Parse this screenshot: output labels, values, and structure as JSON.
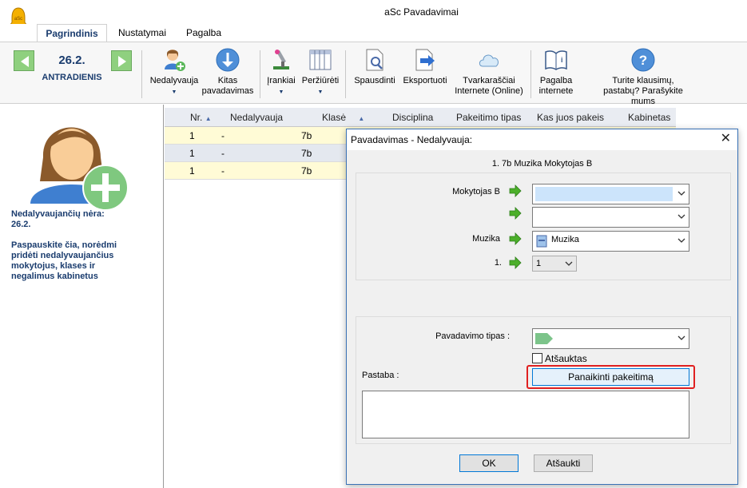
{
  "window": {
    "title": "aSc Pavadavimai"
  },
  "tabs": [
    {
      "label": "Pagrindinis",
      "active": true
    },
    {
      "label": "Nustatymai",
      "active": false
    },
    {
      "label": "Pagalba",
      "active": false
    }
  ],
  "date": {
    "value": "26.2.",
    "weekday": "ANTRADIENIS"
  },
  "toolbar": {
    "absent": {
      "line1": "Nedalyvauja",
      "line2": ""
    },
    "next": {
      "line1": "Kitas",
      "line2": "pavadavimas"
    },
    "tools": {
      "line1": "Įrankiai",
      "line2": ""
    },
    "view": {
      "line1": "Peržiūrėti",
      "line2": ""
    },
    "print": {
      "line1": "Spausdinti",
      "line2": ""
    },
    "export": {
      "line1": "Eksportuoti",
      "line2": ""
    },
    "online": {
      "line1": "Tvarkaraščiai",
      "line2": "Internete (Online)"
    },
    "help": {
      "line1": "Pagalba",
      "line2": "internete"
    },
    "questions": {
      "line1": "Turite klausimų,",
      "line2": "pastabų? Parašykite mums"
    }
  },
  "left_panel": {
    "no_absent": "Nedalyvaujančių nėra:",
    "no_absent_date": "26.2.",
    "hint": [
      "Paspauskite čia, norėdmi",
      "pridėti nedalyvaujančius",
      "mokytojus, klases ir",
      "negalimus kabinetus"
    ]
  },
  "grid": {
    "headers": {
      "nr": "Nr.",
      "absent": "Nedalyvauja",
      "class": "Klasė",
      "subject": "Disciplina",
      "change_type": "Pakeitimo tipas",
      "replacer": "Kas juos pakeis",
      "rooms": "Kabinetas"
    },
    "rows": [
      {
        "nr": "1",
        "absent": "-",
        "class": "7b"
      },
      {
        "nr": "1",
        "absent": "-",
        "class": "7b"
      },
      {
        "nr": "1",
        "absent": "-",
        "class": "7b"
      }
    ]
  },
  "dialog": {
    "title": "Pavadavimas - Nedalyvauja:",
    "header": "1. 7b  Muzika Mokytojas B",
    "teacher_label": "Mokytojas B",
    "subject_label": "Muzika",
    "subject_value": "Muzika",
    "period_label": "1.",
    "period_value": "1",
    "type_label": "Pavadavimo tipas :",
    "cancelled_label": "Atšauktas",
    "cancelled_checked": false,
    "note_label": "Pastaba :",
    "remove_button": "Panaikinti pakeitimą",
    "ok_button": "OK",
    "cancel_button": "Atšaukti"
  },
  "colors": {
    "accent": "#1a3c6e",
    "row_alt_yellow": "#fffbd6",
    "row_selected": "#e4e8ef",
    "green_arrow": "#4caf2a",
    "highlight": "#e02020"
  }
}
